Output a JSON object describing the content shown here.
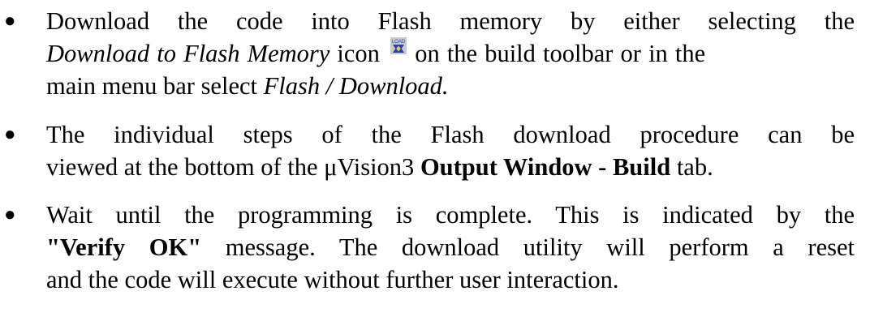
{
  "bullets": [
    {
      "line1": "Download the code into Flash memory by either selecting the",
      "line2_italic": "Download to Flash Memory",
      "line2_a": " icon ",
      "line2_b": " on the build toolbar or in the",
      "line3_a": "main menu bar select ",
      "line3_italic": "Flash / Download.",
      "icon": "download-to-flash-icon",
      "icon_label": "LOAD"
    },
    {
      "line1": "The individual steps of the Flash download procedure can be",
      "line2_a": "viewed at the bottom of the μVision3 ",
      "line2_bold": "Output Window - Build",
      "line2_b": " tab."
    },
    {
      "line1_a": "Wait until the programming is complete. This is indicated by the",
      "line2_bold": "\"Verify OK\"",
      "line2_a": " message. The download utility will perform a reset",
      "line3": "and the code will execute without further user interaction."
    }
  ],
  "colors": {
    "text": "#000000",
    "icon_bg": "#c8c8c8",
    "icon_accent": "#2040c0",
    "icon_highlight": "#f0d020"
  }
}
